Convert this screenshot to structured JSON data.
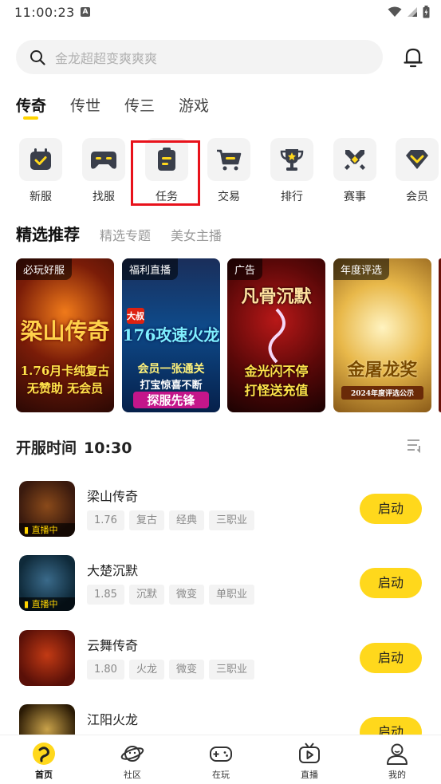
{
  "status_bar": {
    "time": "11:00:23",
    "badge": "A"
  },
  "search": {
    "placeholder": "金龙超超变爽爽爽"
  },
  "category_tabs": [
    {
      "label": "传奇",
      "active": true
    },
    {
      "label": "传世",
      "active": false
    },
    {
      "label": "传三",
      "active": false
    },
    {
      "label": "游戏",
      "active": false
    }
  ],
  "functions": [
    {
      "label": "新服",
      "icon": "calendar-check-icon"
    },
    {
      "label": "找服",
      "icon": "gamepad-icon"
    },
    {
      "label": "任务",
      "icon": "task-clipboard-icon",
      "highlighted": true
    },
    {
      "label": "交易",
      "icon": "shopping-cart-icon"
    },
    {
      "label": "排行",
      "icon": "trophy-icon"
    },
    {
      "label": "赛事",
      "icon": "crossed-swords-icon"
    },
    {
      "label": "会员",
      "icon": "vip-diamond-icon"
    }
  ],
  "featured_tabs": [
    {
      "label": "精选推荐",
      "active": true
    },
    {
      "label": "精选专题",
      "active": false
    },
    {
      "label": "美女主播",
      "active": false
    }
  ],
  "banners": [
    {
      "tag": "必玩好服",
      "title": "梁山传奇",
      "line1": "1.76月卡纯复古",
      "line2": "无赞助 无会员"
    },
    {
      "tag": "福利直播",
      "badge": "大叔",
      "title": "176攻速火龙",
      "line1": "会员一张通关",
      "line2": "打宝惊喜不断",
      "line3": "探服先锋"
    },
    {
      "tag": "广告",
      "title": "凡骨沉默",
      "line1": "金光闪不停",
      "line2": "打怪送充值"
    },
    {
      "tag": "年度评选",
      "title": "金屠龙奖",
      "line1": "2024年度评选公示"
    }
  ],
  "server_section": {
    "title": "开服时间",
    "time": "10:30"
  },
  "games": [
    {
      "name": "梁山传奇",
      "tags": [
        "1.76",
        "复古",
        "经典",
        "三职业"
      ],
      "live": "直播中",
      "launch": "启动",
      "thumb_color": "#3a1a0e"
    },
    {
      "name": "大楚沉默",
      "tags": [
        "1.85",
        "沉默",
        "微变",
        "单职业"
      ],
      "live": "直播中",
      "launch": "启动",
      "thumb_color": "#0f2a3a"
    },
    {
      "name": "云舞传奇",
      "tags": [
        "1.80",
        "火龙",
        "微变",
        "三职业"
      ],
      "live": "",
      "launch": "启动",
      "thumb_color": "#5a1008"
    },
    {
      "name": "江阳火龙",
      "tags": [
        "",
        "",
        "",
        ""
      ],
      "live": "",
      "launch": "启动",
      "thumb_color": "#2a1a05"
    }
  ],
  "bottom_nav": [
    {
      "label": "首页",
      "icon": "home-logo-icon",
      "active": true
    },
    {
      "label": "社区",
      "icon": "planet-icon",
      "active": false
    },
    {
      "label": "在玩",
      "icon": "gamepad-icon",
      "active": false
    },
    {
      "label": "直播",
      "icon": "tv-play-icon",
      "active": false
    },
    {
      "label": "我的",
      "icon": "user-icon",
      "active": false
    }
  ],
  "colors": {
    "accent": "#FFD81C",
    "highlight_border": "#e8121b",
    "text_primary": "#222222",
    "text_secondary": "#999999"
  }
}
